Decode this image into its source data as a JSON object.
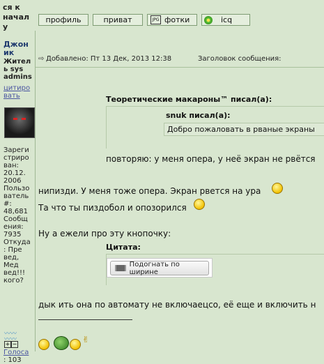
{
  "header": {
    "left_fragment": [
      "ся к",
      "начал",
      "у"
    ],
    "buttons": [
      "профиль",
      "приват",
      "фотки",
      "icq"
    ]
  },
  "user": {
    "name_lines": [
      "Джон",
      "ик"
    ],
    "title_lines": [
      "Жител",
      "ь sys",
      "admins"
    ],
    "quote_link": [
      "цитиро",
      "вать"
    ],
    "info_lines": [
      "Зареги",
      "стриро",
      "ван:",
      "20.12.",
      "2006",
      "Пользо",
      "ватель",
      "#:",
      "48,681",
      "Сообщ",
      "ения:",
      "7935",
      "Откуда",
      ": Пре",
      "вед,",
      "Мед",
      "вед!!!",
      "кого?"
    ],
    "votes_label": "Голоса",
    "votes_value": ": 103"
  },
  "post": {
    "added": "Добавлено: Пт 13 Дек, 2013 12:38",
    "subject_label": "Заголовок сообщения:",
    "quote1_author": "Теоретические макароны™ писал(а):",
    "quote2_author": "snuk писал(а):",
    "quote2_text": "Добро пожаловать в рваные экраны",
    "quote1_text": "повторяю: у меня опера, у неё экран не рвётся",
    "line1": "нипизди. У меня тоже опера. Экран рвется на ура",
    "line2": "Та что ты пиздобол и опозорился",
    "line3": "Ну а ежели про эту кнопочку:",
    "quote3_label": "Цитата:",
    "button_label": "Подогнать по ширине",
    "line4": "дык ить она по автомату не включаецсо, её еще и включить н"
  }
}
